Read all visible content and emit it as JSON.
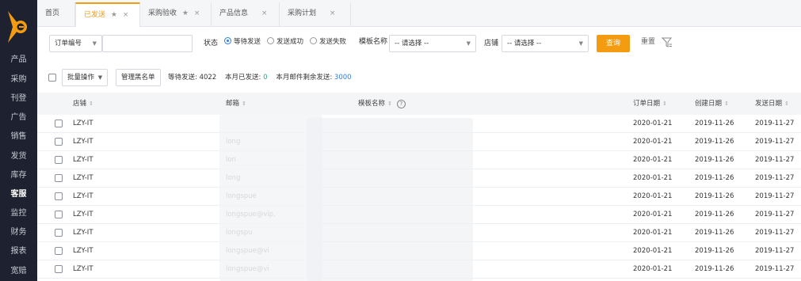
{
  "sidebar": {
    "items": [
      "产品",
      "采购",
      "刊登",
      "广告",
      "销售",
      "发货",
      "库存",
      "客服",
      "监控",
      "财务",
      "报表",
      "宽赔"
    ],
    "active_index": 7
  },
  "tabs": [
    {
      "label": "首页",
      "star": "",
      "close": ""
    },
    {
      "label": "已发送",
      "star": "★",
      "close": "×"
    },
    {
      "label": "采购验收",
      "star": "★",
      "close": "×"
    },
    {
      "label": "产品信息",
      "star": "",
      "close": "×"
    },
    {
      "label": "采购计划",
      "star": "",
      "close": "×"
    }
  ],
  "filter": {
    "order_field": "订单编号",
    "order_value": "",
    "status_label": "状态",
    "status_options": [
      "等待发送",
      "发送成功",
      "发送失败"
    ],
    "status_selected": 0,
    "template_label": "模板名称",
    "template_value": "-- 请选择 --",
    "store_label": "店铺",
    "store_value": "-- 请选择 --",
    "query_label": "查询",
    "reset_label": "重置"
  },
  "toolbar": {
    "batch_label": "批量操作",
    "blacklist_label": "管理黑名单",
    "waiting_label": "等待发送:",
    "waiting_value": "4022",
    "sent_label": "本月已发送:",
    "sent_value": "0",
    "remaining_label": "本月邮件剩余发送:",
    "remaining_value": "3000"
  },
  "table": {
    "headers": {
      "store": "店铺",
      "email": "邮箱",
      "template": "模板名称",
      "order_date": "订单日期",
      "created_date": "创建日期",
      "send_date": "发送日期"
    },
    "rows": [
      {
        "store": "LZY-IT",
        "email": "",
        "order_date": "2020-01-21",
        "created_date": "2019-11-26",
        "send_date": "2019-11-27"
      },
      {
        "store": "LZY-IT",
        "email": "long",
        "order_date": "2020-01-21",
        "created_date": "2019-11-26",
        "send_date": "2019-11-27"
      },
      {
        "store": "LZY-IT",
        "email": "lon",
        "order_date": "2020-01-21",
        "created_date": "2019-11-26",
        "send_date": "2019-11-27"
      },
      {
        "store": "LZY-IT",
        "email": "long",
        "order_date": "2020-01-21",
        "created_date": "2019-11-26",
        "send_date": "2019-11-27"
      },
      {
        "store": "LZY-IT",
        "email": "longspue",
        "order_date": "2020-01-21",
        "created_date": "2019-11-26",
        "send_date": "2019-11-27"
      },
      {
        "store": "LZY-IT",
        "email": "longspue@vip.",
        "order_date": "2020-01-21",
        "created_date": "2019-11-26",
        "send_date": "2019-11-27"
      },
      {
        "store": "LZY-IT",
        "email": "longspu",
        "order_date": "2020-01-21",
        "created_date": "2019-11-26",
        "send_date": "2019-11-27"
      },
      {
        "store": "LZY-IT",
        "email": "longspue@vi",
        "order_date": "2020-01-21",
        "created_date": "2019-11-26",
        "send_date": "2019-11-27"
      },
      {
        "store": "LZY-IT",
        "email": "longspue@vi",
        "order_date": "2020-01-21",
        "created_date": "2019-11-26",
        "send_date": "2019-11-27"
      }
    ]
  },
  "colors": {
    "accent": "#f39c12",
    "sidebar_bg": "#1e2230",
    "link_blue": "#2b7de9"
  }
}
